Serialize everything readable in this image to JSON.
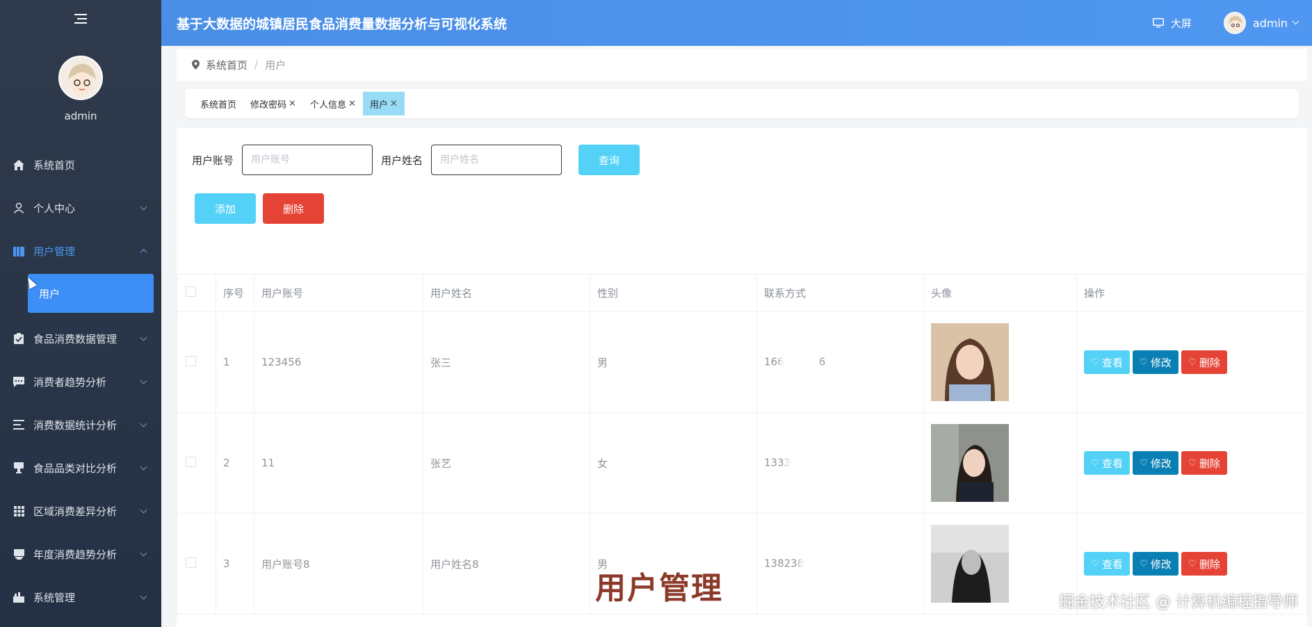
{
  "header": {
    "title": "基于大数据的城镇居民食品消费量数据分析与可视化系统",
    "big_screen_label": "大屏",
    "user_name": "admin"
  },
  "sidebar": {
    "user_name": "admin",
    "items": [
      {
        "label": "系统首页",
        "icon": "home-icon"
      },
      {
        "label": "个人中心",
        "icon": "person-icon"
      },
      {
        "label": "用户管理",
        "icon": "book-icon"
      },
      {
        "label": "食品消费数据管理",
        "icon": "clipboard-icon"
      },
      {
        "label": "消费者趋势分析",
        "icon": "chat-icon"
      },
      {
        "label": "消费数据统计分析",
        "icon": "list-icon"
      },
      {
        "label": "食品品类对比分析",
        "icon": "cup-icon"
      },
      {
        "label": "区域消费差异分析",
        "icon": "grid-icon"
      },
      {
        "label": "年度消费趋势分析",
        "icon": "chart-icon"
      },
      {
        "label": "系统管理",
        "icon": "gear-icon"
      }
    ],
    "sub_item": "用户"
  },
  "breadcrumb": {
    "home": "系统首页",
    "separator": "/",
    "current": "用户"
  },
  "tabs": [
    {
      "label": "系统首页",
      "closable": false
    },
    {
      "label": "修改密码",
      "closable": true
    },
    {
      "label": "个人信息",
      "closable": true
    },
    {
      "label": "用户",
      "closable": true
    }
  ],
  "search": {
    "account_label": "用户账号",
    "account_placeholder": "用户账号",
    "name_label": "用户姓名",
    "name_placeholder": "用户姓名",
    "query_button": "查询"
  },
  "actions": {
    "add": "添加",
    "delete": "删除"
  },
  "table": {
    "headers": [
      "序号",
      "用户账号",
      "用户姓名",
      "性别",
      "联系方式",
      "头像",
      "操作"
    ],
    "rows": [
      {
        "index": "1",
        "account": "123456",
        "name": "张三",
        "gender": "男",
        "phone_visible": "166",
        "phone_tail": "6"
      },
      {
        "index": "2",
        "account": "11",
        "name": "张艺",
        "gender": "女",
        "phone_visible": "1333",
        "phone_tail": ""
      },
      {
        "index": "3",
        "account": "用户账号8",
        "name": "用户姓名8",
        "gender": "男",
        "phone_visible": "138238",
        "phone_tail": ""
      }
    ],
    "row_buttons": {
      "view": "查看",
      "edit": "修改",
      "delete": "删除"
    }
  },
  "overlay": {
    "caption": "用户管理",
    "watermark": "掘金技术社区 @ 计算机编程指导师"
  },
  "colors": {
    "header": "#4a8ee6",
    "sidebar": "#2f3b4c",
    "accent": "#3d8ff5",
    "query": "#53d1f6",
    "danger": "#e44336",
    "edit": "#0a7fb3"
  }
}
